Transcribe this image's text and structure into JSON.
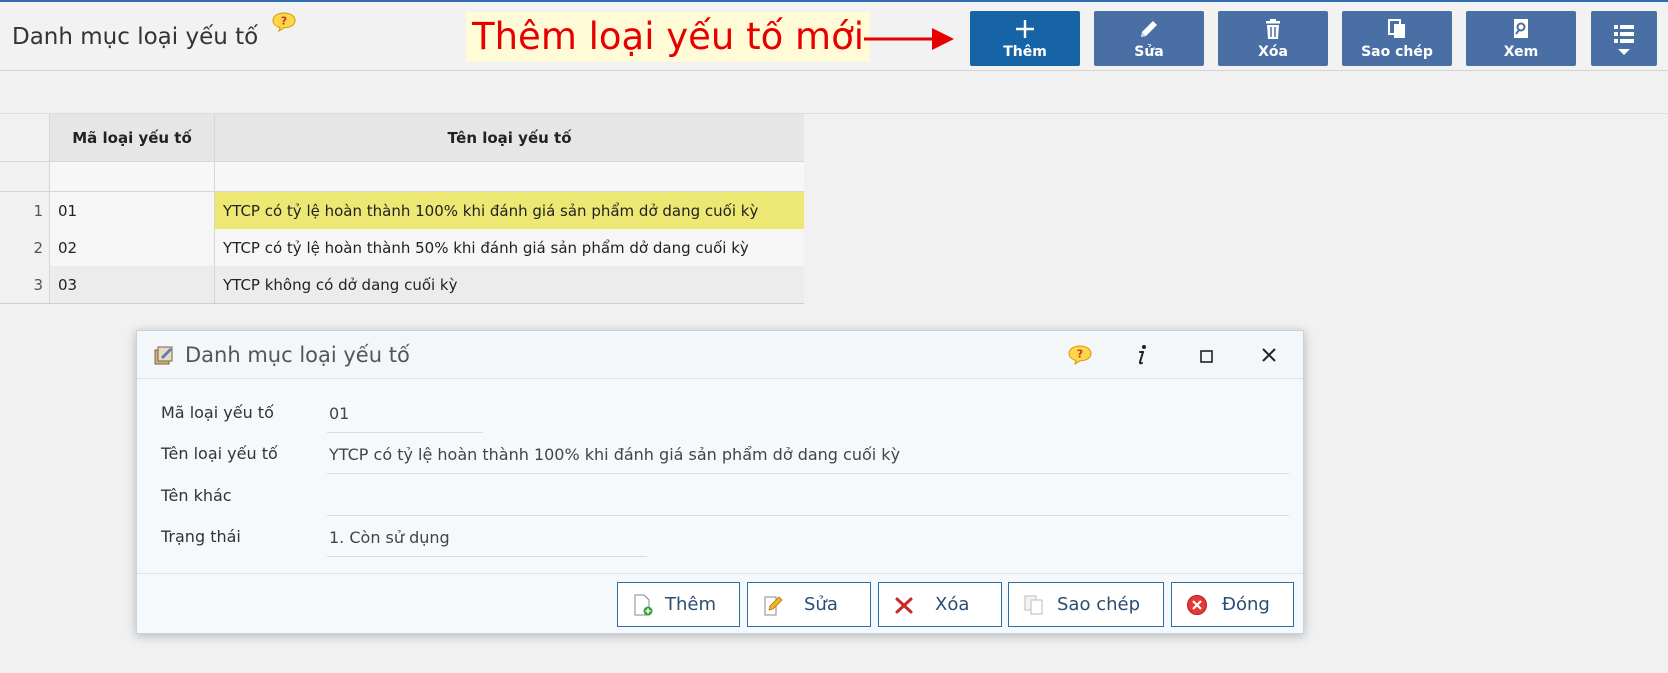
{
  "page": {
    "title": "Danh mục loại yếu tố",
    "callout": "Thêm loại yếu tố mới"
  },
  "toolbar": [
    {
      "label": "Thêm",
      "icon": "plus-icon"
    },
    {
      "label": "Sửa",
      "icon": "pencil-icon"
    },
    {
      "label": "Xóa",
      "icon": "trash-icon"
    },
    {
      "label": "Sao chép",
      "icon": "copy-icon"
    },
    {
      "label": "Xem",
      "icon": "view-icon"
    },
    {
      "label": "",
      "icon": "list-menu-icon"
    }
  ],
  "grid": {
    "columns": [
      "Mã loại yếu tố",
      "Tên loại yếu tố"
    ],
    "rows": [
      {
        "index": "1",
        "code": "01",
        "name": "YTCP có tỷ lệ hoàn thành 100% khi đánh giá sản phẩm dở dang cuối kỳ",
        "selected": true
      },
      {
        "index": "2",
        "code": "02",
        "name": "YTCP có tỷ lệ hoàn thành 50% khi đánh giá sản phẩm dở dang cuối kỳ",
        "selected": false
      },
      {
        "index": "3",
        "code": "03",
        "name": "YTCP không có dở dang cuối kỳ",
        "selected": false
      }
    ]
  },
  "dialog": {
    "title": "Danh mục loại yếu tố",
    "fields": [
      {
        "label": "Mã loại yếu tố",
        "value": "01"
      },
      {
        "label": "Tên loại yếu tố",
        "value": "YTCP có tỷ lệ hoàn thành 100% khi đánh giá sản phẩm dở dang cuối kỳ"
      },
      {
        "label": "Tên khác",
        "value": ""
      },
      {
        "label": "Trạng thái",
        "value": "1. Còn sử dụng"
      }
    ],
    "buttons": [
      {
        "label": "Thêm",
        "icon": "add-doc-icon"
      },
      {
        "label": "Sửa",
        "icon": "edit-doc-icon"
      },
      {
        "label": "Xóa",
        "icon": "x-mark-icon"
      },
      {
        "label": "Sao chép",
        "icon": "copy-doc-icon"
      },
      {
        "label": "Đóng",
        "icon": "close-circle-icon"
      }
    ]
  },
  "colors": {
    "toolbar_primary": "#1663a6",
    "toolbar_button": "#4a6fa5",
    "selected_row": "#ede874",
    "callout_text": "#e60000"
  }
}
